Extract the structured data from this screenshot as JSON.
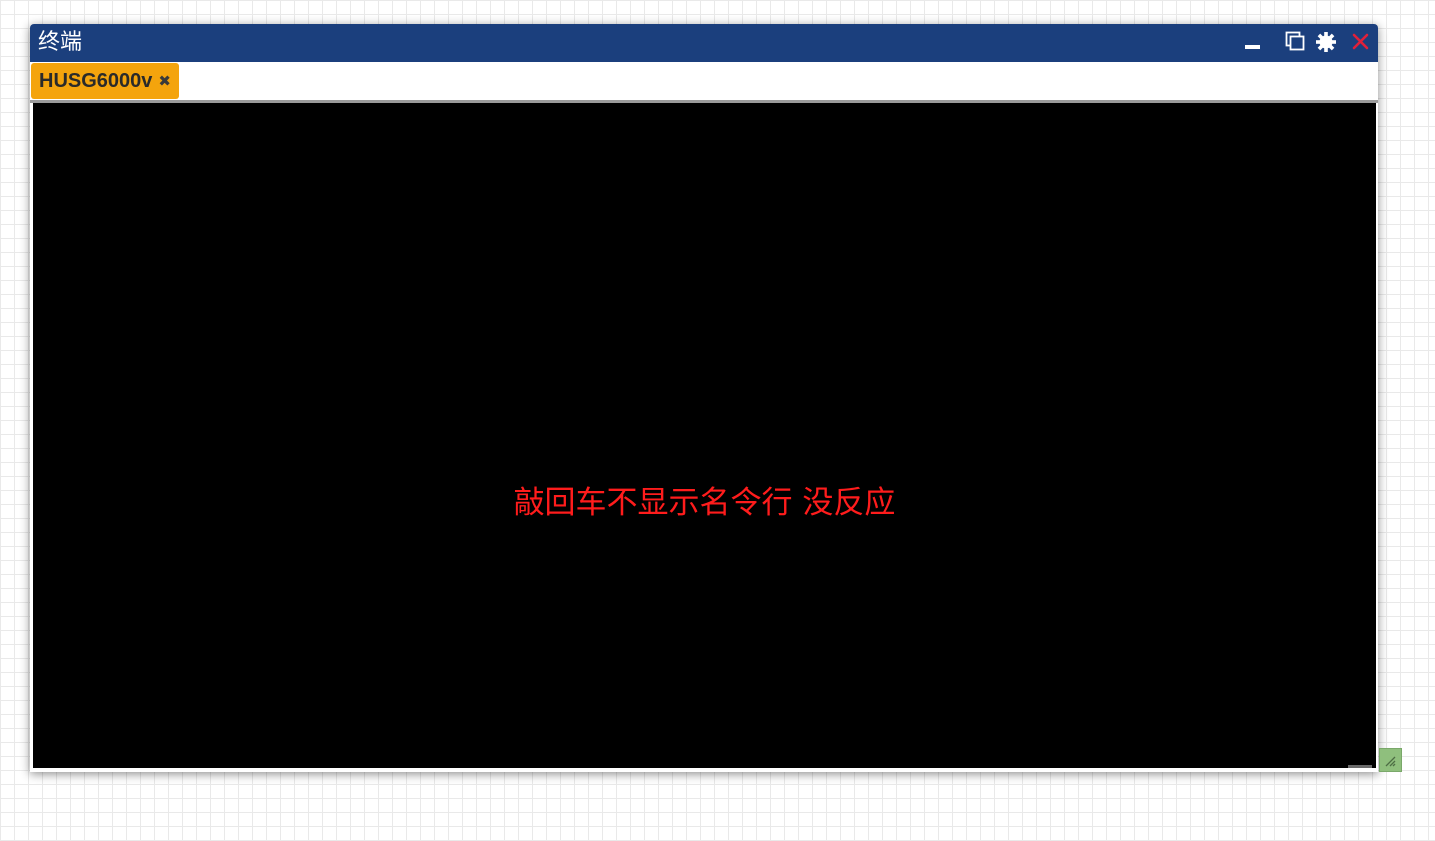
{
  "window": {
    "title": "终端"
  },
  "title_controls": {
    "minimize": "minimize-icon",
    "restore": "restore-icon",
    "settings": "gear-icon",
    "close": "close-icon"
  },
  "tabs": [
    {
      "label": "HUSG6000v",
      "close_glyph": "✖"
    }
  ],
  "terminal": {
    "annotation": "敲回车不显示名令行 没反应"
  },
  "colors": {
    "titlebar": "#1b3f7d",
    "tab_active": "#f4a40d",
    "terminal_bg": "#000000",
    "annotation_text": "#ff1c1c",
    "close_icon": "#e0203a",
    "resize_handle": "#8fbf7d"
  },
  "resize_handle": "resize-grip-icon"
}
